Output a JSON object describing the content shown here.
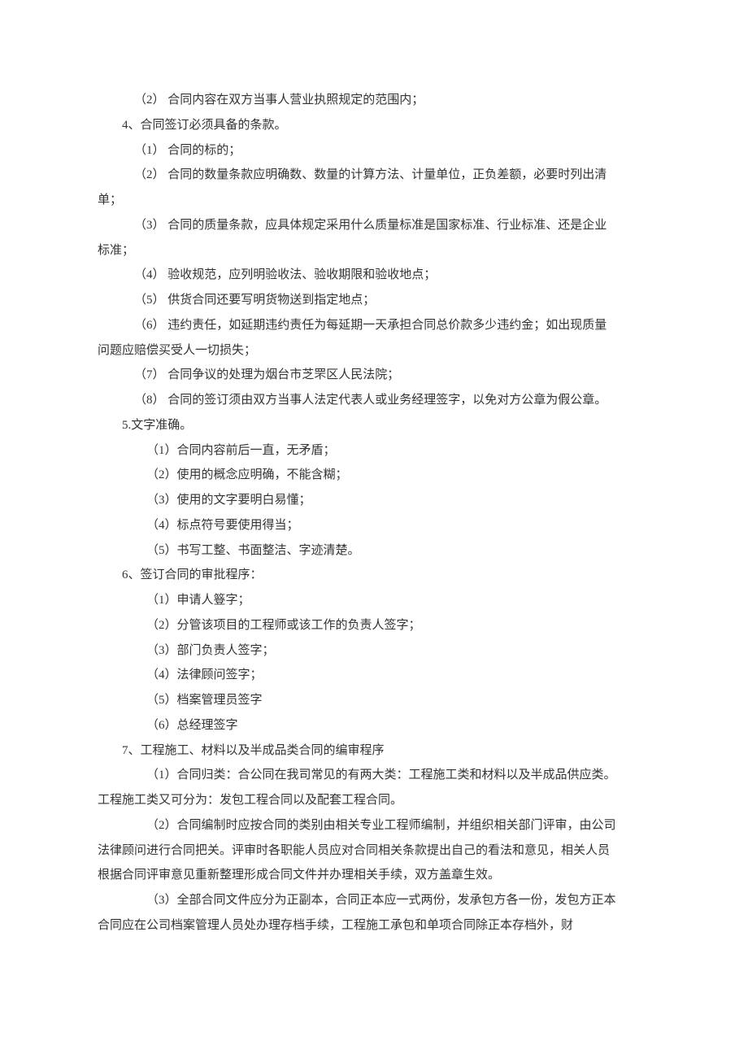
{
  "lines": [
    {
      "indent": 2,
      "text": "（2） 合同内容在双方当事人营业执照规定的范围内；"
    },
    {
      "indent": 1,
      "text": "4、合同签订必须具备的条款。"
    },
    {
      "indent": 2,
      "text": "（1） 合同的标的；"
    },
    {
      "indent": 2,
      "text": "（2） 合同的数量条款应明确数、数量的计算方法、计量单位，正负差额，必要时列出清"
    },
    {
      "indent": 0,
      "text": "单；"
    },
    {
      "indent": 2,
      "text": "（3） 合同的质量条款，应具体规定采用什么质量标准是国家标准、行业标准、还是企业"
    },
    {
      "indent": 0,
      "text": "标准；"
    },
    {
      "indent": 2,
      "text": "（4） 验收规范，应列明验收法、验收期限和验收地点；"
    },
    {
      "indent": 2,
      "text": "（5） 供货合同还要写明货物送到指定地点；"
    },
    {
      "indent": 2,
      "text": "（6） 违约责任，如延期违约责任为每延期一天承担合同总价款多少违约金；如出现质量"
    },
    {
      "indent": 0,
      "text": "问题应赔偿买受人一切损失；"
    },
    {
      "indent": 2,
      "text": "（7） 合同争议的处理为烟台市芝罘区人民法院；"
    },
    {
      "indent": 2,
      "text": "（8） 合同的签订须由双方当事人法定代表人或业务经理签字，以免对方公章为假公章。"
    },
    {
      "indent": 1,
      "text": "5.文字准确。"
    },
    {
      "indent": 3,
      "text": "（1）合同内容前后一直，无矛盾；"
    },
    {
      "indent": 3,
      "text": "（2）使用的概念应明确，不能含糊；"
    },
    {
      "indent": 3,
      "text": "（3）使用的文字要明白易懂；"
    },
    {
      "indent": 3,
      "text": "（4）标点符号要使用得当；"
    },
    {
      "indent": 3,
      "text": "（5）书写工整、书面整洁、字迹清楚。"
    },
    {
      "indent": 1,
      "text": "6、签订合同的审批程序："
    },
    {
      "indent": 3,
      "text": "（1）申请人簦字；"
    },
    {
      "indent": 3,
      "text": "（2）分管该项目的工程师或该工作的负责人签字；"
    },
    {
      "indent": 3,
      "text": "（3）部门负责人签字；"
    },
    {
      "indent": 3,
      "text": "（4）法律顾问签字；"
    },
    {
      "indent": 3,
      "text": "（5）档案管理员签字"
    },
    {
      "indent": 3,
      "text": "（6）总经理签字"
    },
    {
      "indent": 1,
      "text": "7、工程施工、材料以及半成品类合同的编审程序"
    },
    {
      "indent": 3,
      "text": "（1）合同归类：合公同在我司常见的有两大类：工程施工类和材料以及半成品供应类。"
    },
    {
      "indent": 0,
      "text": "工程施工类又可分为：发包工程合同以及配套工程合同。"
    },
    {
      "indent": 3,
      "text": "（2）合同编制时应按合同的类别由相关专业工程师编制，并组织相关部门评审，由公司"
    },
    {
      "indent": 0,
      "text": "法律顾问进行合同把关。评审时各职能人员应对合同相关条款提出自己的看法和意见，相关人员"
    },
    {
      "indent": 0,
      "text": "根据合同评审意见重新整理形成合同文件并办理相关手续，双方盖章生效。"
    },
    {
      "indent": 3,
      "text": "（3）全部合同文件应分为正副本，合同正本应一式两份，发承包方各一份，发包方正本"
    },
    {
      "indent": 0,
      "text": "合同应在公司档案管理人员处办理存档手续，工程施工承包和单项合同除正本存档外，财"
    }
  ]
}
